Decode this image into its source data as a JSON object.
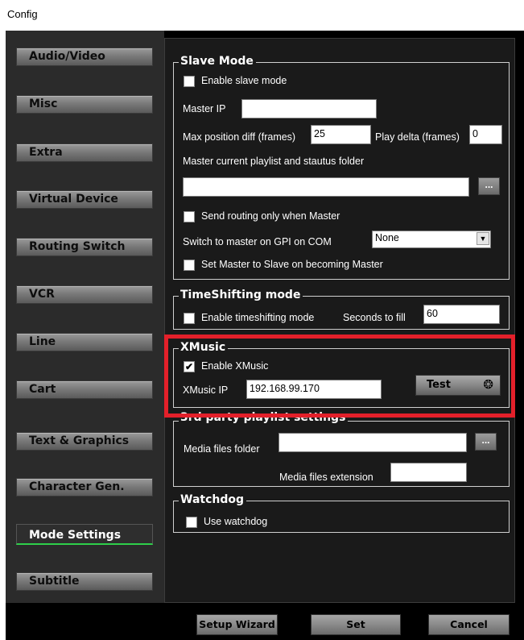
{
  "window": {
    "title": "Config"
  },
  "sidebar": {
    "items": [
      {
        "label": "Audio/Video"
      },
      {
        "label": "Misc"
      },
      {
        "label": "Extra"
      },
      {
        "label": "Virtual Device"
      },
      {
        "label": "Routing Switch"
      },
      {
        "label": "VCR"
      },
      {
        "label": "Line"
      },
      {
        "label": "Cart"
      },
      {
        "label": "Text & Graphics"
      },
      {
        "label": "Character Gen."
      },
      {
        "label": "Mode Settings",
        "active": true
      },
      {
        "label": "Subtitle"
      }
    ]
  },
  "slave_mode": {
    "title": "Slave Mode",
    "enable_label": "Enable slave mode",
    "enable_checked": false,
    "master_ip_label": "Master IP",
    "master_ip_value": "",
    "max_pos_diff_label": "Max position diff (frames)",
    "max_pos_diff_value": "25",
    "play_delta_label": "Play delta (frames)",
    "play_delta_value": "0",
    "playlist_folder_label": "Master current playlist and stautus folder",
    "playlist_folder_value": "",
    "browse_label": "...",
    "send_routing_label": "Send routing only when Master",
    "send_routing_checked": false,
    "switch_master_label": "Switch to master on GPI on COM",
    "switch_master_value": "None",
    "set_master_label": "Set Master to Slave on becoming Master",
    "set_master_checked": false
  },
  "timeshifting": {
    "title": "TimeShifting mode",
    "enable_label": "Enable timeshifting mode",
    "enable_checked": false,
    "seconds_label": "Seconds to fill",
    "seconds_value": "60"
  },
  "xmusic": {
    "title": "XMusic",
    "enable_label": "Enable XMusic",
    "enable_checked": true,
    "ip_label": "XMusic IP",
    "ip_value": "192.168.99.170",
    "test_label": "Test",
    "highlight_color": "#e3202a"
  },
  "third_party": {
    "title": "3rd party playlist settings",
    "media_folder_label": "Media files folder",
    "media_folder_value": "",
    "browse_label": "...",
    "media_ext_label": "Media files extension",
    "media_ext_value": ""
  },
  "watchdog": {
    "title": "Watchdog",
    "use_label": "Use watchdog",
    "use_checked": false
  },
  "footer": {
    "setup_wizard_label": "Setup Wizard",
    "set_label": "Set",
    "cancel_label": "Cancel"
  },
  "colors": {
    "active_tab_underline": "#2ecf4a",
    "panel_background": "#1a1a1a"
  }
}
